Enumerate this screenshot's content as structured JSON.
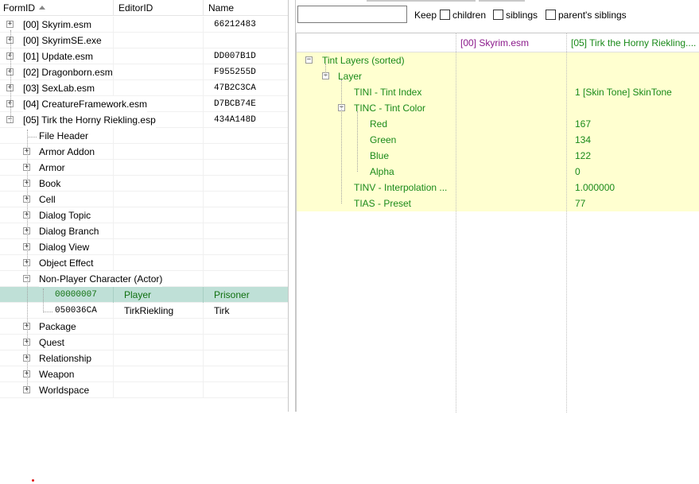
{
  "left_panel": {
    "columns": {
      "formid": "FormID",
      "editorid": "EditorID",
      "name": "Name"
    },
    "plugins": [
      {
        "label": "[00] Skyrim.esm",
        "formid": "66212483"
      },
      {
        "label": "[00] SkyrimSE.exe",
        "formid": ""
      },
      {
        "label": "[01] Update.esm",
        "formid": "DD007B1D"
      },
      {
        "label": "[02] Dragonborn.esm",
        "formid": "F955255D"
      },
      {
        "label": "[03] SexLab.esm",
        "formid": "47B2C3CA"
      },
      {
        "label": "[04] CreatureFramework.esm",
        "formid": "D7BCB74E"
      },
      {
        "label": "[05] Tirk the Horny Riekling.esp",
        "formid": "434A148D"
      }
    ],
    "groups": [
      "File Header",
      "Armor Addon",
      "Armor",
      "Book",
      "Cell",
      "Dialog Topic",
      "Dialog Branch",
      "Dialog View",
      "Object Effect",
      "Non-Player Character (Actor)"
    ],
    "npc_records": [
      {
        "formid": "00000007",
        "editorid": "Player",
        "name": "Prisoner"
      },
      {
        "formid": "050036CA",
        "editorid": "TirkRiekling",
        "name": "Tirk"
      }
    ],
    "groups_after": [
      "Package",
      "Quest",
      "Relationship",
      "Weapon",
      "Worldspace"
    ]
  },
  "filter": {
    "value": "",
    "keep_label": "Keep",
    "children_label": "children",
    "siblings_label": "siblings",
    "parents_siblings_label": "parent's siblings"
  },
  "record_view": {
    "col1_header": "[00] Skyrim.esm",
    "col2_header": "[05] Tirk the Horny Riekling....",
    "rows": [
      {
        "label": "Tint Layers (sorted)",
        "value": ""
      },
      {
        "label": "Layer",
        "value": ""
      },
      {
        "label": "TINI - Tint Index",
        "value": "1 [Skin Tone] SkinTone"
      },
      {
        "label": "TINC - Tint Color",
        "value": ""
      },
      {
        "label": "Red",
        "value": "167"
      },
      {
        "label": "Green",
        "value": "134"
      },
      {
        "label": "Blue",
        "value": "122"
      },
      {
        "label": "Alpha",
        "value": "0"
      },
      {
        "label": "TINV - Interpolation ...",
        "value": "1.000000"
      },
      {
        "label": "TIAS - Preset",
        "value": "77"
      }
    ]
  },
  "colors": {
    "selected_row": "#bfe0d7",
    "record_text": "#1a8a1a",
    "record_bg": "#ffffd0",
    "skyrim_header": "#8b1a8b"
  },
  "icons": {
    "expand": "plus-box-icon",
    "collapse": "minus-box-icon",
    "sort": "sort-ascending-icon"
  }
}
